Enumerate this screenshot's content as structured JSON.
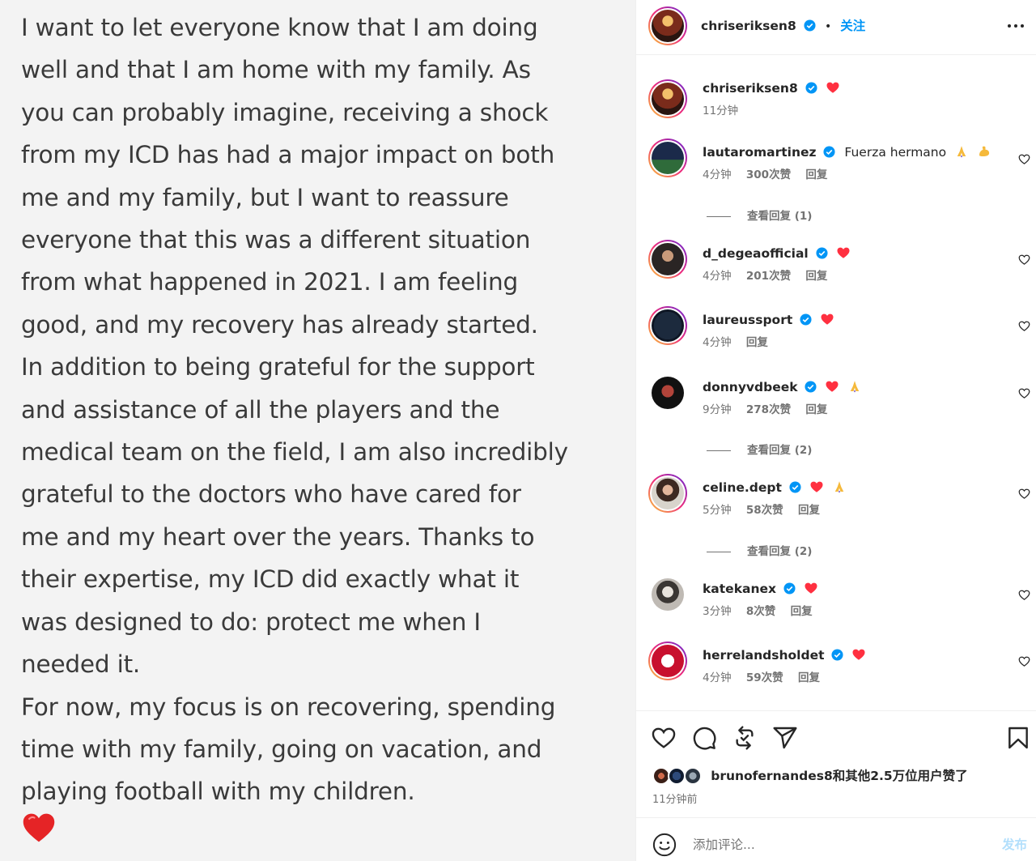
{
  "media": {
    "lines": [
      "I want to let everyone know that I am doing",
      "well and that I am home with my family. As",
      "you can probably imagine, receiving a shock",
      "from my ICD has had a major impact on both",
      "me and my family, but I want to reassure",
      "everyone that this was a different situation",
      "from what happened in 2021. I am feeling",
      "good, and my recovery has already started.",
      "In addition to being grateful for the support",
      "and assistance of all the players and the",
      "medical team on the field, I am also incredibly",
      "grateful to the doctors who have cared for",
      "me and my heart over the years. Thanks to",
      "their expertise, my ICD did exactly what it",
      "was designed to do: protect me when I",
      "needed it.",
      "For now, my focus is on recovering, spending",
      "time with my family, going on vacation, and",
      "playing football with my children."
    ],
    "emoji": "red-heart"
  },
  "header": {
    "username": "chriseriksen8",
    "separator": "•",
    "follow_label": "关注",
    "more_icon": "more-horizontal-icon"
  },
  "comments": [
    {
      "username": "chriseriksen8",
      "text": "",
      "emojis": [
        "heart"
      ],
      "time": "11分钟",
      "likes": "",
      "reply": "",
      "caption": true
    },
    {
      "username": "lautaromartinez",
      "text": "Fuerza hermano",
      "emojis": [
        "pray",
        "muscle"
      ],
      "time": "4分钟",
      "likes": "300次赞",
      "reply": "回复",
      "view_replies": "查看回复 (1)"
    },
    {
      "username": "d_degeaofficial",
      "text": "",
      "emojis": [
        "heart"
      ],
      "time": "4分钟",
      "likes": "201次赞",
      "reply": "回复"
    },
    {
      "username": "laureussport",
      "text": "",
      "emojis": [
        "heart"
      ],
      "time": "4分钟",
      "likes": "",
      "reply": "回复"
    },
    {
      "username": "donnyvdbeek",
      "text": "",
      "emojis": [
        "heart",
        "pray"
      ],
      "time": "9分钟",
      "likes": "278次赞",
      "reply": "回复",
      "view_replies": "查看回复 (2)"
    },
    {
      "username": "celine.dept",
      "text": "",
      "emojis": [
        "heart",
        "pray"
      ],
      "time": "5分钟",
      "likes": "58次赞",
      "reply": "回复",
      "view_replies": "查看回复 (2)"
    },
    {
      "username": "katekanex",
      "text": "",
      "emojis": [
        "heart"
      ],
      "time": "3分钟",
      "likes": "8次赞",
      "reply": "回复"
    },
    {
      "username": "herrelandsholdet",
      "text": "",
      "emojis": [
        "heart"
      ],
      "time": "4分钟",
      "likes": "59次赞",
      "reply": "回复"
    }
  ],
  "actions": {
    "icons": [
      "like-icon",
      "comment-icon",
      "repost-icon",
      "share-icon",
      "save-icon"
    ],
    "liked_by": "brunofernandes8和其他2.5万位用户赞了",
    "posted_time": "11分钟前"
  },
  "add_comment": {
    "placeholder": "添加评论...",
    "post_label": "发布"
  },
  "colors": {
    "link_blue": "#0095f6",
    "heart_red": "#ff3040",
    "post_disabled": "#b2dffc",
    "meta_gray": "#737373"
  }
}
